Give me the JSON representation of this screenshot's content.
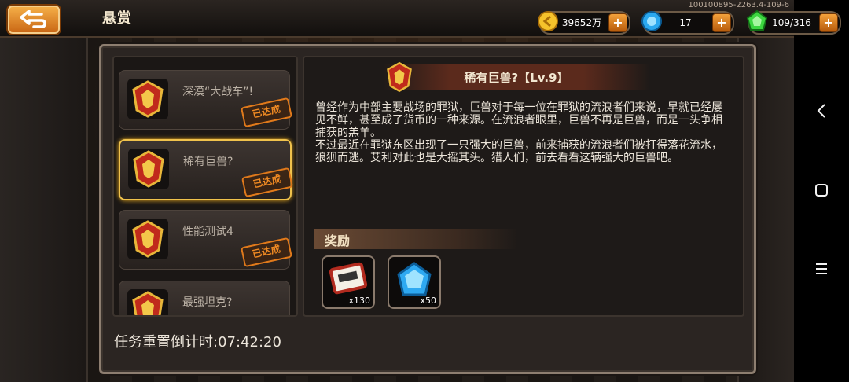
{
  "header": {
    "title": "悬赏",
    "debug_code": "100100895-2263.4-109-6",
    "resources": [
      {
        "name": "gold",
        "icon": "gold-coin-icon",
        "value": "39652万"
      },
      {
        "name": "crystal",
        "icon": "blue-crystal-icon",
        "value": "17"
      },
      {
        "name": "energy",
        "icon": "green-energy-icon",
        "value": "109/316"
      }
    ]
  },
  "quests": [
    {
      "name": "深漠“大战车”!",
      "status": "已达成",
      "selected": false
    },
    {
      "name": "稀有巨兽?",
      "status": "已达成",
      "selected": true
    },
    {
      "name": "性能测试4",
      "status": "已达成",
      "selected": false
    },
    {
      "name": "最强坦克?",
      "status": "",
      "selected": false
    }
  ],
  "detail": {
    "title": "稀有巨兽?【Lv.9】",
    "paragraph1": "曾经作为中部主要战场的罪狱，巨兽对于每一位在罪狱的流浪者们来说，早就已经屡见不鲜，甚至成了货币的一种来源。在流浪者眼里，巨兽不再是巨兽，而是一头争相捕获的羔羊。",
    "paragraph2": "不过最近在罪狱东区出现了一只强大的巨兽，前来捕获的流浪者们被打得落花流水，狼狈而逃。艾利对此也是大摇其头。猎人们，前去看看这辆强大的巨兽吧。",
    "reward_label": "奖励",
    "rewards": [
      {
        "icon": "coupon-ticket-icon",
        "qty": "x130"
      },
      {
        "icon": "blue-gem-icon",
        "qty": "x50"
      }
    ]
  },
  "countdown": {
    "label": "任务重置倒计时:",
    "time": "07:42:20"
  },
  "colors": {
    "accent_orange": "#f08a23",
    "selected_border": "#f0c24c",
    "panel_bg": "#1e1a18"
  }
}
